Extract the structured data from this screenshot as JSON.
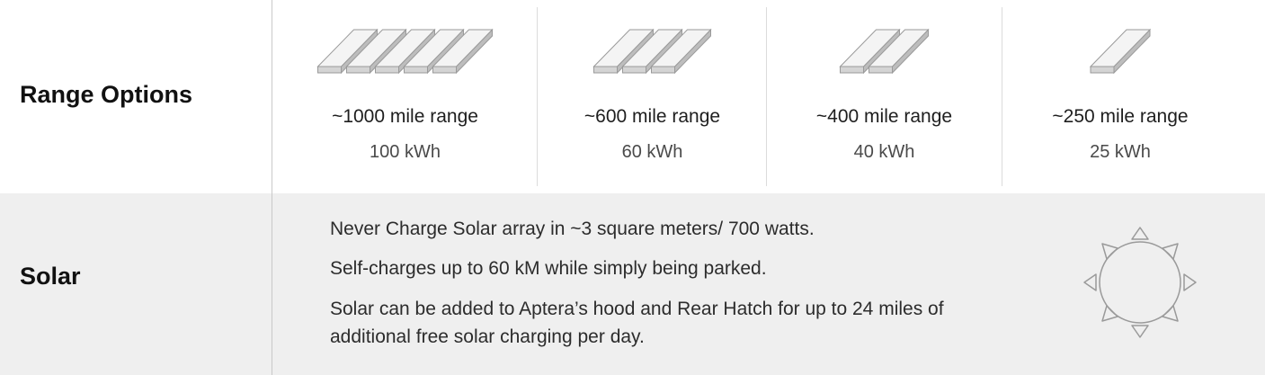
{
  "range": {
    "label": "Range Options",
    "options": [
      {
        "range": "~1000 mile range",
        "capacity": "100 kWh",
        "panels": 5,
        "icon": "battery-pack-icon"
      },
      {
        "range": "~600 mile range",
        "capacity": "60 kWh",
        "panels": 3,
        "icon": "battery-pack-icon"
      },
      {
        "range": "~400 mile range",
        "capacity": "40 kWh",
        "panels": 2,
        "icon": "battery-pack-icon"
      },
      {
        "range": "~250 mile range",
        "capacity": "25 kWh",
        "panels": 1,
        "icon": "battery-pack-icon"
      }
    ]
  },
  "solar": {
    "label": "Solar",
    "lines": [
      "Never Charge Solar array in ~3 square meters/ 700 watts.",
      "Self-charges up to 60 kM while simply being parked.",
      "Solar can be added to Aptera’s hood and Rear Hatch for up to 24 miles of",
      "additional free solar charging per day."
    ],
    "icon": "sun-icon"
  },
  "colors": {
    "solar_background": "#efefef",
    "divider": "#c9c9c9",
    "icon_stroke": "#9a9a9a"
  }
}
